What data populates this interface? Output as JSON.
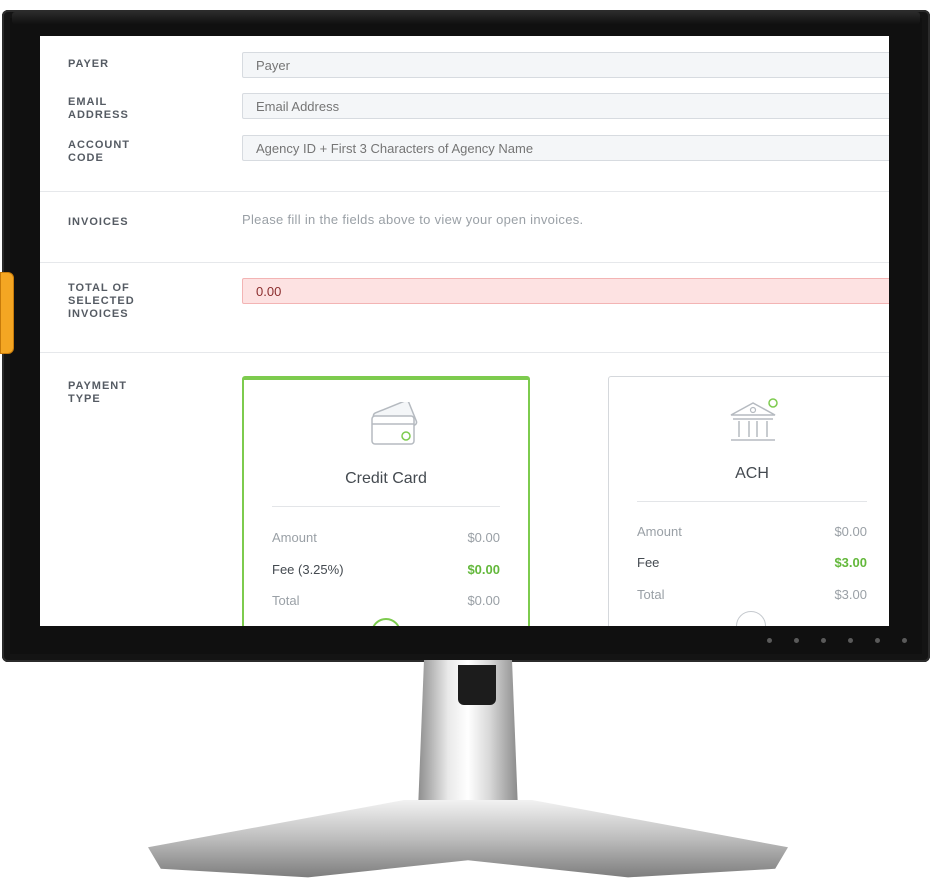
{
  "form": {
    "payer_label": "PAYER",
    "payer_placeholder": "Payer",
    "email_label_1": "EMAIL",
    "email_label_2": "ADDRESS",
    "email_placeholder": "Email Address",
    "account_label_1": "ACCOUNT",
    "account_label_2": "CODE",
    "account_placeholder": "Agency ID + First 3 Characters of Agency Name",
    "invoices_label": "INVOICES",
    "invoices_note": "Please fill in the fields above to view your open invoices.",
    "total_label_1": "TOTAL OF",
    "total_label_2": "SELECTED",
    "total_label_3": "INVOICES",
    "total_value": "0.00",
    "payment_type_label_1": "PAYMENT",
    "payment_type_label_2": "TYPE"
  },
  "payment_options": {
    "credit_card": {
      "title": "Credit Card",
      "selected": true,
      "icon": "credit-card-icon",
      "amount_label": "Amount",
      "amount_value": "$0.00",
      "fee_label": "Fee (3.25%)",
      "fee_value": "$0.00",
      "total_label": "Total",
      "total_value": "$0.00"
    },
    "ach": {
      "title": "ACH",
      "selected": false,
      "icon": "bank-icon",
      "amount_label": "Amount",
      "amount_value": "$0.00",
      "fee_label": "Fee",
      "fee_value": "$3.00",
      "total_label": "Total",
      "total_value": "$3.00"
    }
  },
  "colors": {
    "accent_green": "#7dcb4e",
    "fee_green": "#63b83b",
    "total_field_bg": "#fde2e2"
  }
}
